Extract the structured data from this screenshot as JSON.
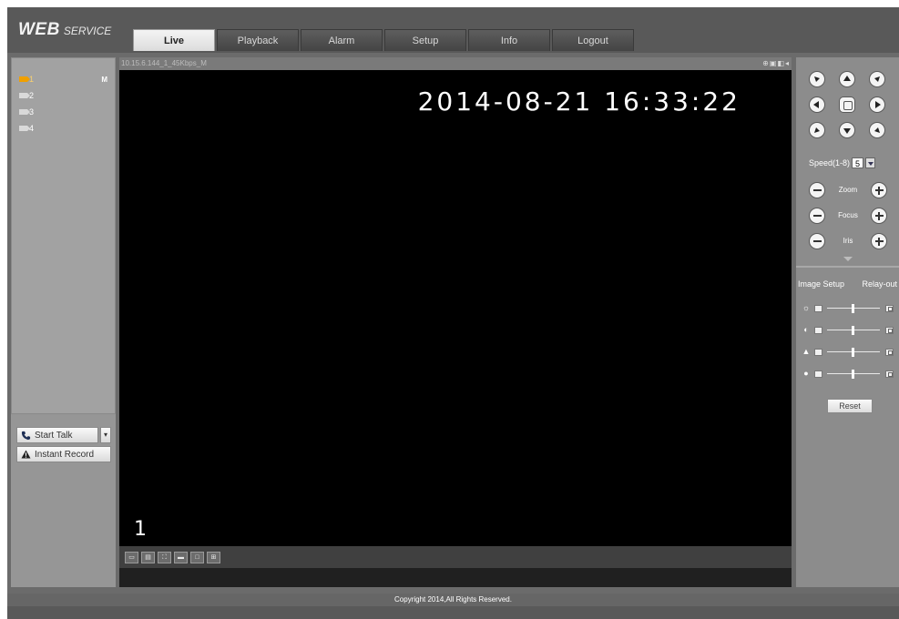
{
  "app": {
    "brand_main": "WEB",
    "brand_sub": "SERVICE"
  },
  "tabs": [
    {
      "label": "Live",
      "active": true
    },
    {
      "label": "Playback"
    },
    {
      "label": "Alarm"
    },
    {
      "label": "Setup"
    },
    {
      "label": "Info"
    },
    {
      "label": "Logout"
    }
  ],
  "channels": [
    {
      "label": "1",
      "active": true,
      "flag": "M"
    },
    {
      "label": "2"
    },
    {
      "label": "3"
    },
    {
      "label": "4"
    }
  ],
  "talk": {
    "start_talk_label": "Start Talk",
    "instant_record_label": "Instant Record"
  },
  "video": {
    "stream_info": "10.15.6.144_1_45Kbps_M",
    "osd_time": "2014-08-21 16:33:22",
    "osd_channel": "1"
  },
  "ptz": {
    "speed_label": "Speed(1-8)",
    "speed_value": "5",
    "zoom_label": "Zoom",
    "focus_label": "Focus",
    "iris_label": "Iris"
  },
  "image_panel": {
    "tab_image_setup": "Image Setup",
    "tab_relay_out": "Relay-out",
    "reset_label": "Reset"
  },
  "footer": {
    "copyright": "Copyright 2014,All Rights Reserved."
  },
  "icons": {
    "channel": "camera-icon",
    "talk": "phone-icon",
    "record": "warning-icon",
    "brightness": "sun-icon",
    "contrast": "contrast-icon",
    "saturation": "saturation-icon",
    "hue": "hue-icon"
  },
  "colors": {
    "active_channel": "#f0a000",
    "accent_arrow": "#335588"
  }
}
